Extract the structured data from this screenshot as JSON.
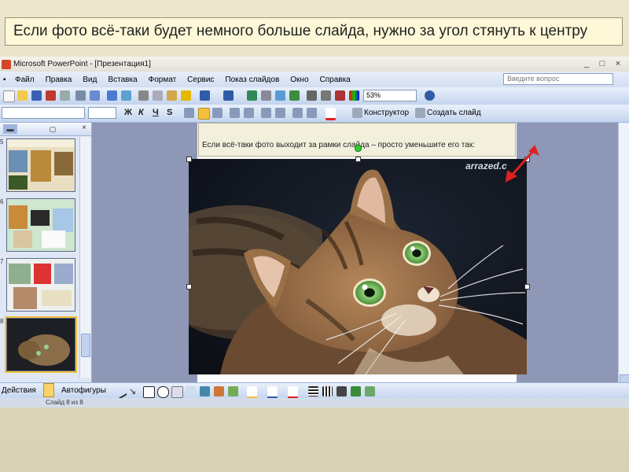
{
  "caption": "Если фото всё-таки будет немного больше слайда, нужно за угол стянуть к центру",
  "window": {
    "title": "Microsoft PowerPoint - [Презентация1]",
    "buttons": [
      "_",
      "□",
      "×"
    ]
  },
  "menu": {
    "items": [
      "Файл",
      "Правка",
      "Вид",
      "Вставка",
      "Формат",
      "Сервис",
      "Показ слайдов",
      "Окно",
      "Справка"
    ],
    "ask_placeholder": "Введите вопрос"
  },
  "toolbar": {
    "zoom": "53%",
    "design_label": "Конструктор",
    "new_slide_label": "Создать слайд",
    "format_buttons": [
      "Ж",
      "К",
      "Ч",
      "S"
    ]
  },
  "panel": {
    "tab_icons": [
      "slides-tab-icon",
      "outline-tab-icon"
    ],
    "close": "×",
    "thumbnails": [
      {
        "num": "5"
      },
      {
        "num": "6"
      },
      {
        "num": "7"
      },
      {
        "num": "8"
      }
    ]
  },
  "slide": {
    "title_text": "Если всё-таки фото выходит за рамки слайда – просто уменьшите его так:",
    "watermark": "arrazed.c"
  },
  "drawing": {
    "actions_label": "Действия",
    "autoshapes_label": "Автофигуры"
  },
  "status": {
    "text": "Слайд 8 из 8"
  },
  "colors": {
    "arrow": "#e02020",
    "caption_bg": "#fff8d8",
    "toolbar_blue": "#c4d4ee"
  }
}
